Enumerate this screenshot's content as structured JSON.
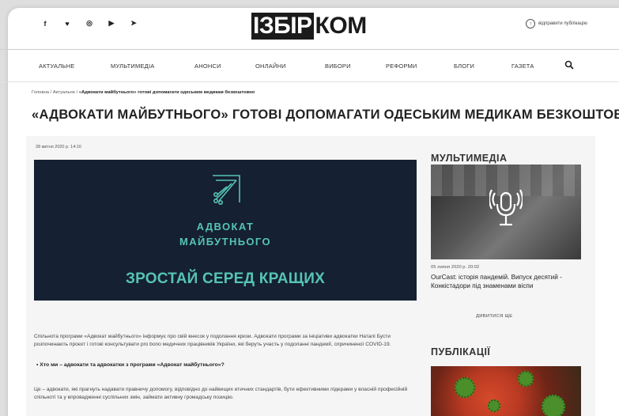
{
  "header": {
    "social": [
      "f",
      "♥",
      "◎",
      "▶",
      "➤"
    ],
    "logo_dark": "ІЗБІР",
    "logo_light": "КОМ",
    "signup_label": "відправити публікацію"
  },
  "nav": {
    "items": [
      "АКТУАЛЬНЕ",
      "МУЛЬТИМЕДІА",
      "АНОНСИ",
      "ОНЛАЙНИ",
      "ВИБОРИ",
      "РЕФОРМИ",
      "БЛОГИ",
      "ГАЗЕТА"
    ]
  },
  "breadcrumb": {
    "home": "Головна",
    "sep1": "/",
    "section": "Актуальне",
    "sep2": "/",
    "current": "«Адвокати майбутнього» готові допомагати одеським медикам безкоштовно"
  },
  "article": {
    "title": "«АДВОКАТИ МАЙБУТНЬОГО» ГОТОВІ ДОПОМАГАТИ ОДЕСЬКИМ МЕДИКАМ БЕЗКОШТОВНО",
    "date": "28 квітня 2020 р. 14:16",
    "hero_line1": "АДВОКАТ",
    "hero_line2": "МАЙБУТНЬОГО",
    "hero_line3": "ЗРОСТАЙ СЕРЕД КРАЩИХ",
    "para1": "Спільнота програми «Адвокат майбутнього» інформує про свій внесок у подолання кризи. Адвокати програми за ініціативи адвокатки Наталі Бусти розпочинають проєкт і готові консультувати pro bono медичних працівників України, які беруть участь у подоланні пандемії, спричиненої COVID-19.",
    "bullet": "Хто ми – адвокати та адвокатки з програми «Адвокат майбутнього»?",
    "para2": "Це – адвокати, які прагнуть надавати правничу допомогу, відповідно до найвищих етичних стандартів, бути ефективними лідерами у власній професійній спільноті та у впровадженні суспільних змін, займати активну громадську позицію."
  },
  "sidebar": {
    "media_heading": "МУЛЬТИМЕДІА",
    "media_date": "05 липня 2020 р. 20:02",
    "media_title": "OurCast: історія пандемій. Випуск десятий - Конкістадори під знаменами віспи",
    "more_label": "ДИВИТИСЯ ЩЕ",
    "pub_heading": "ПУБЛІКАЦІЇ"
  },
  "colors": {
    "hero_bg": "#152032",
    "hero_accent": "#56c4b4",
    "logo_dark": "#1b1b1b"
  }
}
